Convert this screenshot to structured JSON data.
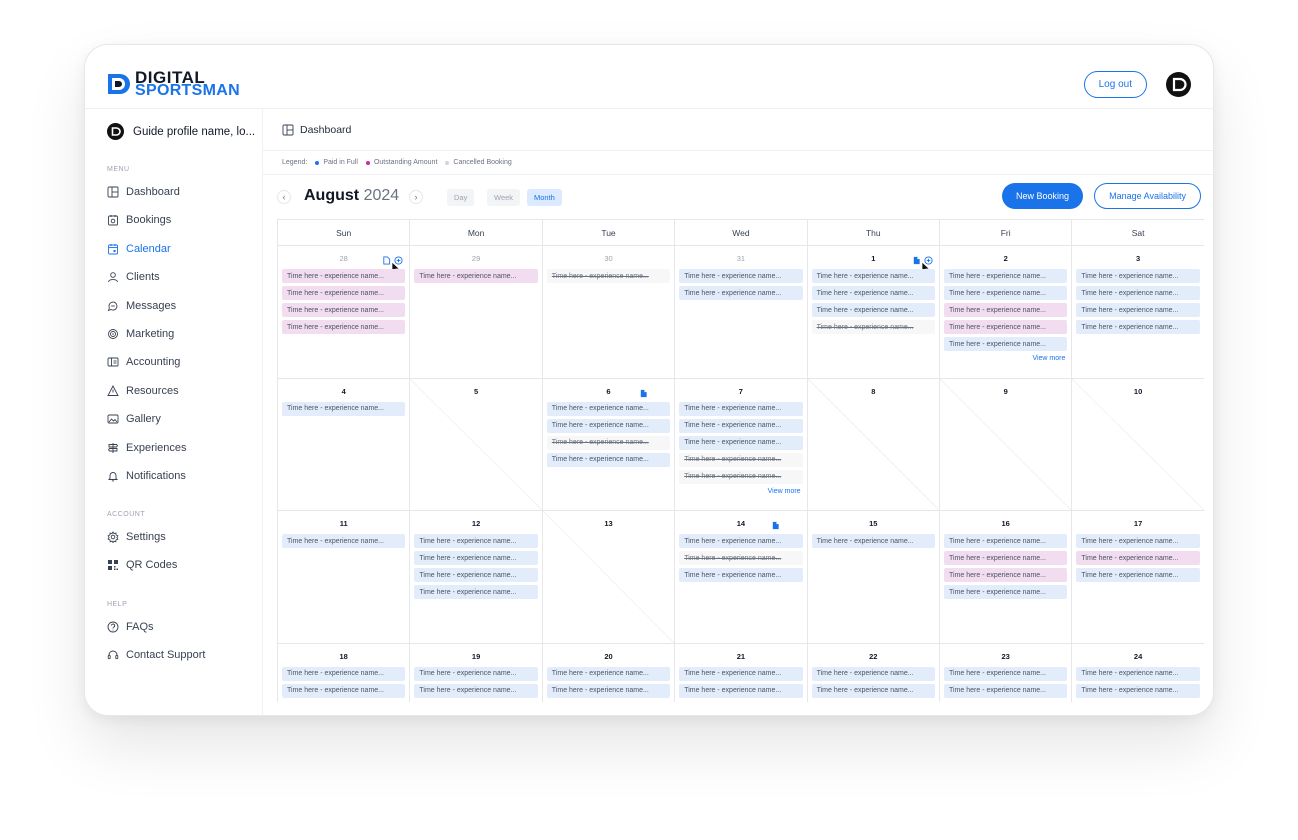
{
  "brand": {
    "line1": "DIGITAL",
    "line2": "SPORTSMAN"
  },
  "header": {
    "logout_label": "Log out"
  },
  "sidebar": {
    "profile_name": "Guide profile name, lo...",
    "menu_label": "MENU",
    "menu": [
      {
        "label": "Dashboard",
        "icon": "dashboard-icon"
      },
      {
        "label": "Bookings",
        "icon": "bookings-icon"
      },
      {
        "label": "Calendar",
        "icon": "calendar-icon",
        "active": true
      },
      {
        "label": "Clients",
        "icon": "clients-icon"
      },
      {
        "label": "Messages",
        "icon": "messages-icon"
      },
      {
        "label": "Marketing",
        "icon": "marketing-icon"
      },
      {
        "label": "Accounting",
        "icon": "accounting-icon"
      },
      {
        "label": "Resources",
        "icon": "resources-icon"
      },
      {
        "label": "Gallery",
        "icon": "gallery-icon"
      },
      {
        "label": "Experiences",
        "icon": "experiences-icon"
      },
      {
        "label": "Notifications",
        "icon": "bell-icon"
      }
    ],
    "account_label": "ACCOUNT",
    "account": [
      {
        "label": "Settings",
        "icon": "gear-icon"
      },
      {
        "label": "QR Codes",
        "icon": "qr-code-icon"
      }
    ],
    "help_label": "HELP",
    "help": [
      {
        "label": "FAQs",
        "icon": "question-icon"
      },
      {
        "label": "Contact Support",
        "icon": "headset-icon"
      }
    ]
  },
  "breadcrumb": {
    "label": "Dashboard"
  },
  "legend": {
    "label": "Legend:",
    "items": [
      {
        "label": "Paid in Full",
        "color": "#1a73e8"
      },
      {
        "label": "Outstanding Amount",
        "color": "#d6249f"
      },
      {
        "label": "Cancelled Booking",
        "color": "#d1d5db"
      }
    ]
  },
  "toolbar": {
    "month": "August",
    "year": "2024",
    "views": [
      "Day",
      "Week",
      "Month"
    ],
    "active_view": "Month",
    "new_booking": "New Booking",
    "manage_availability": "Manage Availability"
  },
  "calendar": {
    "weekdays": [
      "Sun",
      "Mon",
      "Tue",
      "Wed",
      "Thu",
      "Fri",
      "Sat"
    ],
    "event_text": "Time here - experience name...",
    "view_more": "View more",
    "weeks": [
      [
        {
          "day": "28",
          "muted": true,
          "icons": [
            "doc",
            "add"
          ],
          "cursor": true,
          "events": [
            "out",
            "out",
            "out",
            "out"
          ]
        },
        {
          "day": "29",
          "muted": true,
          "events": [
            "out"
          ]
        },
        {
          "day": "30",
          "muted": true,
          "events": [
            "can"
          ]
        },
        {
          "day": "31",
          "muted": true,
          "events": [
            "paid",
            "paid"
          ]
        },
        {
          "day": "1",
          "icons": [
            "docfill",
            "add"
          ],
          "cursor": true,
          "events": [
            "paid",
            "paid",
            "paid",
            "can"
          ]
        },
        {
          "day": "2",
          "events": [
            "paid",
            "paid",
            "out",
            "out",
            "paid"
          ],
          "more": true
        },
        {
          "day": "3",
          "events": [
            "paid",
            "paid",
            "paid",
            "paid"
          ]
        }
      ],
      [
        {
          "day": "4",
          "events": [
            "paid"
          ]
        },
        {
          "day": "5",
          "blocked": true,
          "events": []
        },
        {
          "day": "6",
          "icons": [
            "docfill"
          ],
          "events": [
            "paid",
            "paid",
            "can",
            "paid"
          ]
        },
        {
          "day": "7",
          "events": [
            "paid",
            "paid",
            "paid",
            "can",
            "can"
          ],
          "more": true
        },
        {
          "day": "8",
          "blocked": true,
          "events": []
        },
        {
          "day": "9",
          "blocked": true,
          "events": []
        },
        {
          "day": "10",
          "blocked": true,
          "events": []
        }
      ],
      [
        {
          "day": "11",
          "events": [
            "paid"
          ]
        },
        {
          "day": "12",
          "events": [
            "paid",
            "paid",
            "paid",
            "paid"
          ]
        },
        {
          "day": "13",
          "blocked": true,
          "events": []
        },
        {
          "day": "14",
          "icons": [
            "docfill"
          ],
          "events": [
            "paid",
            "can",
            "paid"
          ]
        },
        {
          "day": "15",
          "events": [
            "paid"
          ]
        },
        {
          "day": "16",
          "events": [
            "paid",
            "out",
            "out",
            "paid"
          ]
        },
        {
          "day": "17",
          "events": [
            "paid",
            "out",
            "paid"
          ]
        }
      ],
      [
        {
          "day": "18",
          "events": [
            "paid",
            "paid"
          ]
        },
        {
          "day": "19",
          "events": [
            "paid",
            "paid"
          ]
        },
        {
          "day": "20",
          "events": [
            "paid",
            "paid"
          ]
        },
        {
          "day": "21",
          "events": [
            "paid",
            "paid"
          ]
        },
        {
          "day": "22",
          "events": [
            "paid",
            "paid"
          ]
        },
        {
          "day": "23",
          "events": [
            "paid",
            "paid"
          ]
        },
        {
          "day": "24",
          "events": [
            "paid",
            "paid"
          ]
        }
      ]
    ]
  },
  "colors": {
    "accent": "#1a73e8",
    "outstanding": "#d6249f",
    "paid_bg": "#e3ecfb",
    "outstanding_bg": "#f1dcf0"
  }
}
